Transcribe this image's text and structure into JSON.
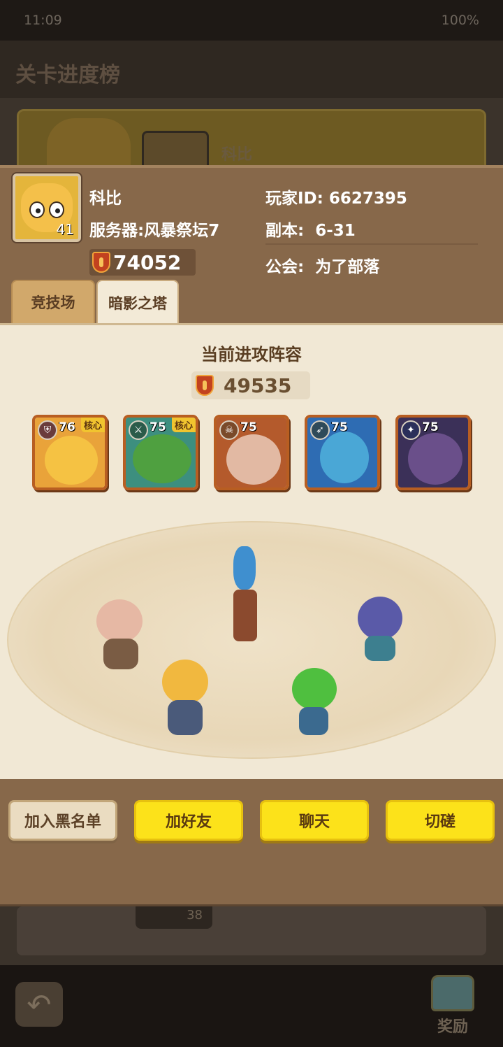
{
  "status_bar": {
    "time": "11:09",
    "battery": "100%"
  },
  "background": {
    "title": "关卡进度榜",
    "row1_name": "科比",
    "row2_level": "38",
    "reward_label": "奖励"
  },
  "profile": {
    "name": "科比",
    "level": "41",
    "server_label": "服务器:",
    "server_value": "风暴祭坛7",
    "power": "74052",
    "player_id_label": "玩家ID:",
    "player_id_value": "6627395",
    "dungeon_label": "副本:",
    "dungeon_value": "6-31",
    "guild_label": "公会:",
    "guild_value": "为了部落"
  },
  "tabs": [
    {
      "label": "竞技场",
      "active": false
    },
    {
      "label": "暗影之塔",
      "active": true
    }
  ],
  "lineup": {
    "title": "当前进攻阵容",
    "power": "49535",
    "heroes": [
      {
        "level": "76",
        "core": "核心",
        "role_icon": "shield-icon",
        "bg": "#e9a33a"
      },
      {
        "level": "75",
        "core": "核心",
        "role_icon": "crossed-swords-icon",
        "bg": "#3d8f7f"
      },
      {
        "level": "75",
        "core": "",
        "role_icon": "skull-icon",
        "bg": "#b45a2c"
      },
      {
        "level": "75",
        "core": "",
        "role_icon": "bow-icon",
        "bg": "#2e6cb3"
      },
      {
        "level": "75",
        "core": "",
        "role_icon": "staff-icon",
        "bg": "#3b3058"
      }
    ]
  },
  "actions": {
    "blacklist": "加入黑名单",
    "add_friend": "加好友",
    "chat": "聊天",
    "spar": "切磋"
  }
}
